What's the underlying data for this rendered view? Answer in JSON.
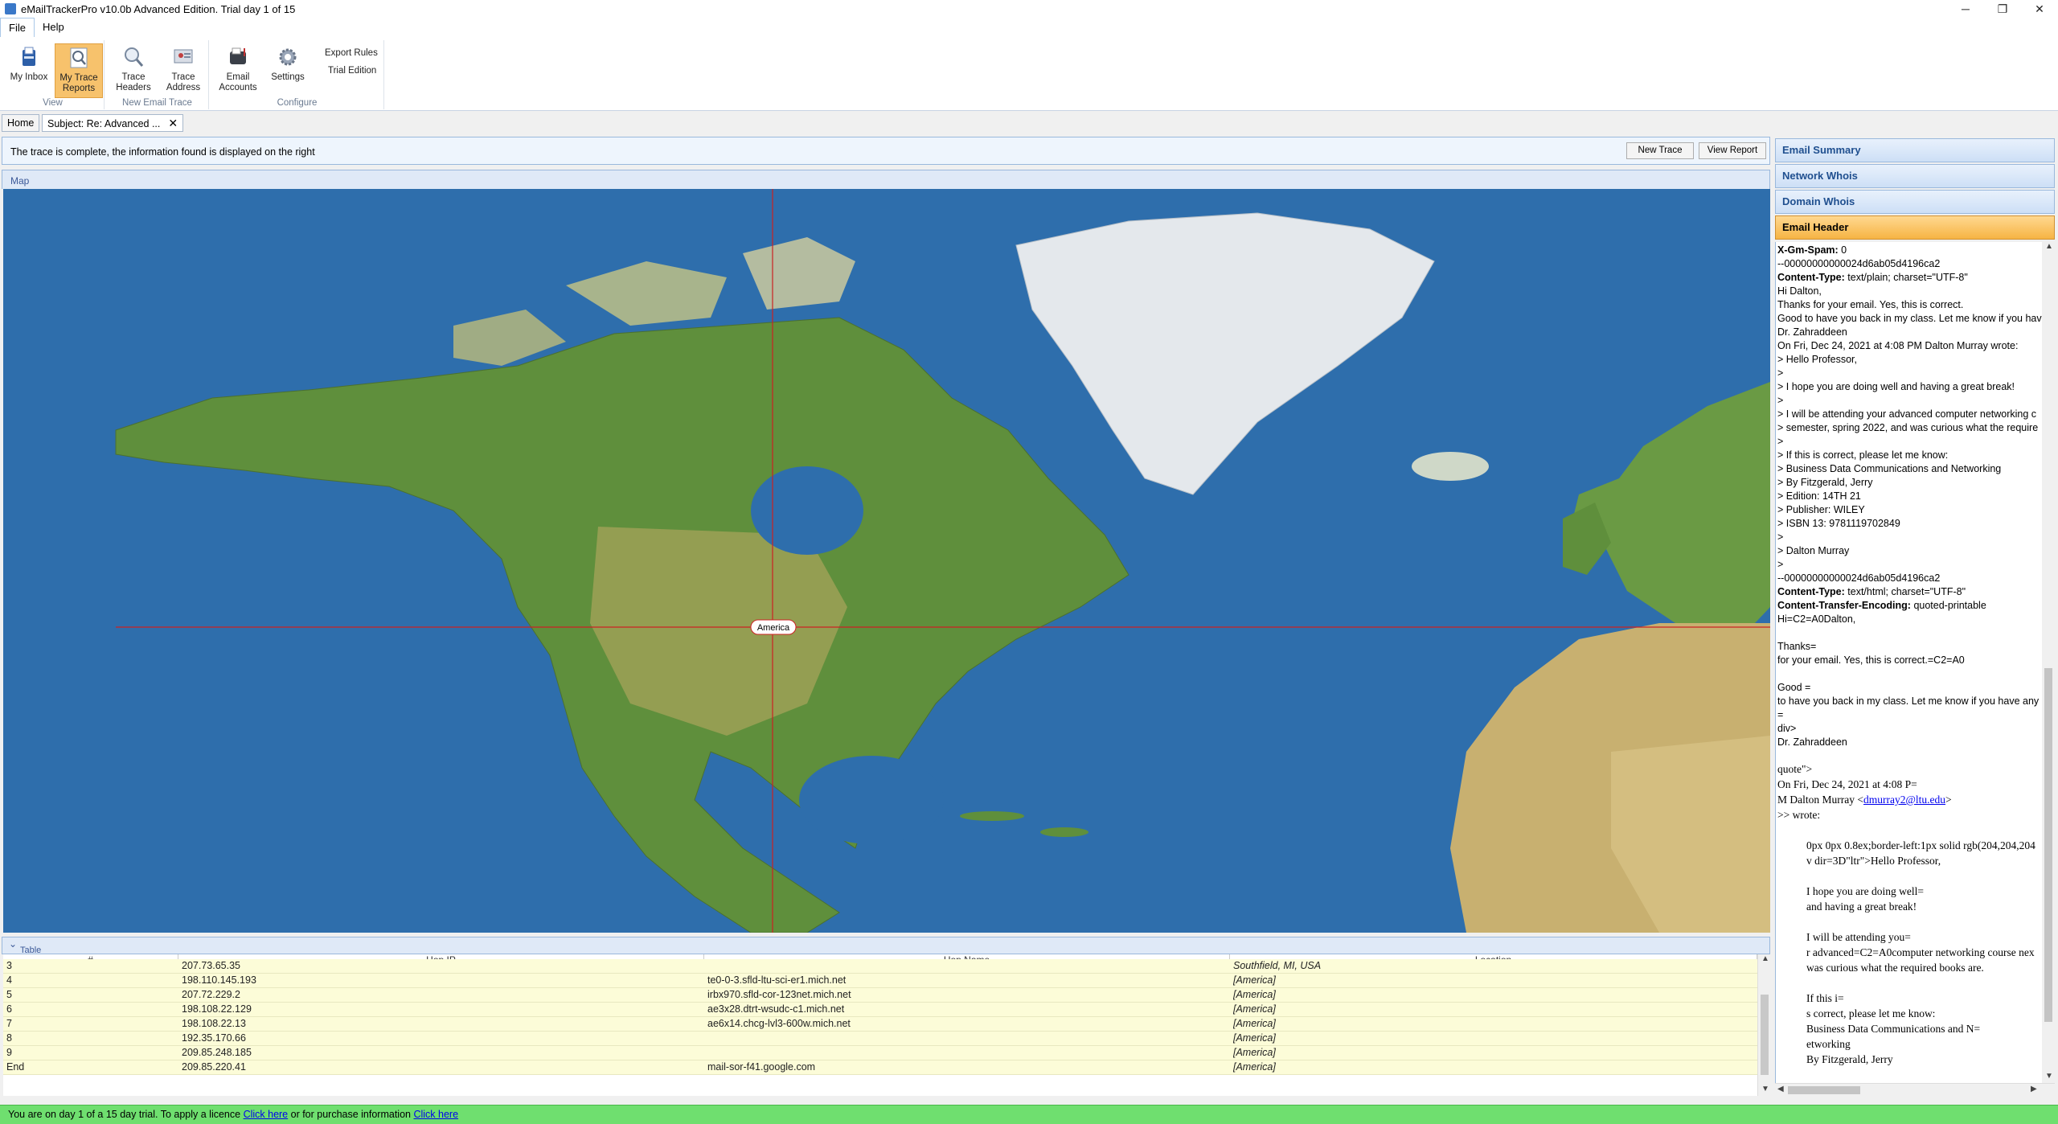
{
  "window": {
    "title": "eMailTrackerPro v10.0b Advanced Edition. Trial day 1 of 15",
    "minimize": "─",
    "restore": "❐",
    "close": "✕"
  },
  "menu": {
    "file": "File",
    "help": "Help"
  },
  "ribbon": {
    "my_inbox": "My Inbox",
    "my_trace_reports": "My Trace Reports",
    "view_group": "View",
    "trace_headers": "Trace Headers",
    "trace_address": "Trace Address",
    "new_trace_group": "New Email Trace",
    "email_accounts": "Email Accounts",
    "settings": "Settings",
    "export_rules": "Export Rules",
    "trial_edition": "Trial Edition",
    "configure_group": "Configure"
  },
  "tabs": {
    "home": "Home",
    "subject": "Subject: Re: Advanced ...",
    "close": "✕"
  },
  "message": {
    "text": "The trace is complete, the information found is displayed on the right",
    "new_trace": "New Trace",
    "view_report": "View Report"
  },
  "map": {
    "header": "Map",
    "marker_label": "America"
  },
  "table": {
    "header": "Table",
    "columns": [
      "#",
      "Hop IP",
      "Hop Name",
      "Location"
    ],
    "rows": [
      {
        "n": "3",
        "ip": "207.73.65.35",
        "name": "",
        "loc": "Southfield, MI, USA"
      },
      {
        "n": "4",
        "ip": "198.110.145.193",
        "name": "te0-0-3.sfld-ltu-sci-er1.mich.net",
        "loc": "[America]"
      },
      {
        "n": "5",
        "ip": "207.72.229.2",
        "name": "irbx970.sfld-cor-123net.mich.net",
        "loc": "[America]"
      },
      {
        "n": "6",
        "ip": "198.108.22.129",
        "name": "ae3x28.dtrt-wsudc-c1.mich.net",
        "loc": "[America]"
      },
      {
        "n": "7",
        "ip": "198.108.22.13",
        "name": "ae6x14.chcg-lvl3-600w.mich.net",
        "loc": "[America]"
      },
      {
        "n": "8",
        "ip": "192.35.170.66",
        "name": "",
        "loc": "[America]"
      },
      {
        "n": "9",
        "ip": "209.85.248.185",
        "name": "",
        "loc": "[America]"
      },
      {
        "n": "End",
        "ip": "209.85.220.41",
        "name": "mail-sor-f41.google.com",
        "loc": "[America]"
      }
    ]
  },
  "trial": {
    "prefix": "You are on day 1 of a 15 day trial. To apply a licence ",
    "link1": "Click here",
    "middle": " or for purchase information ",
    "link2": "Click here"
  },
  "panel": {
    "email_summary": "Email Summary",
    "network_whois": "Network Whois",
    "domain_whois": "Domain Whois",
    "email_header": "Email Header"
  },
  "header_lines": [
    {
      "bold": "X-Gm-Spam:",
      "text": " 0"
    },
    {
      "bold": "",
      "text": "--00000000000024d6ab05d4196ca2"
    },
    {
      "bold": "Content-Type:",
      "text": " text/plain; charset=\"UTF-8\""
    },
    {
      "bold": "",
      "text": "Hi Dalton,"
    },
    {
      "bold": "",
      "text": "Thanks for your email. Yes, this is correct."
    },
    {
      "bold": "",
      "text": "Good to have you back in my class. Let me know if you have"
    },
    {
      "bold": "",
      "text": "Dr. Zahraddeen"
    },
    {
      "bold": "",
      "text": "On Fri, Dec 24, 2021 at 4:08 PM Dalton Murray  wrote:"
    },
    {
      "bold": "",
      "text": "> Hello Professor,"
    },
    {
      "bold": "",
      "text": ">"
    },
    {
      "bold": "",
      "text": "> I hope you are doing well and having a great break!"
    },
    {
      "bold": "",
      "text": ">"
    },
    {
      "bold": "",
      "text": "> I will be attending your advanced computer networking c"
    },
    {
      "bold": "",
      "text": "> semester, spring 2022, and was curious what the require"
    },
    {
      "bold": "",
      "text": ">"
    },
    {
      "bold": "",
      "text": "> If this is correct, please let me know:"
    },
    {
      "bold": "",
      "text": "> Business Data Communications and Networking"
    },
    {
      "bold": "",
      "text": "> By Fitzgerald, Jerry"
    },
    {
      "bold": "",
      "text": "> Edition: 14TH 21"
    },
    {
      "bold": "",
      "text": "> Publisher: WILEY"
    },
    {
      "bold": "",
      "text": "> ISBN 13: 9781119702849"
    },
    {
      "bold": "",
      "text": ">"
    },
    {
      "bold": "",
      "text": "> Dalton Murray"
    },
    {
      "bold": "",
      "text": ">"
    },
    {
      "bold": "",
      "text": "--00000000000024d6ab05d4196ca2"
    },
    {
      "bold": "Content-Type:",
      "text": " text/html; charset=\"UTF-8\""
    },
    {
      "bold": "Content-Transfer-Encoding:",
      "text": " quoted-printable"
    },
    {
      "bold": "",
      "text": "Hi=C2=A0Dalton,"
    },
    {
      "bold": "",
      "text": ""
    },
    {
      "bold": "",
      "text": "Thanks="
    },
    {
      "bold": "",
      "text": "for your email. Yes, this is correct.=C2=A0"
    },
    {
      "bold": "",
      "text": ""
    },
    {
      "bold": "",
      "text": "Good ="
    },
    {
      "bold": "",
      "text": "to have you back in my class. Let me know if you have any q"
    },
    {
      "bold": "",
      "text": "="
    },
    {
      "bold": "",
      "text": "div>"
    },
    {
      "bold": "",
      "text": "Dr. Zahraddeen"
    }
  ],
  "html_lines": [
    {
      "text": "quote\">",
      "indent": 0
    },
    {
      "text": "On Fri, Dec 24, 2021 at 4:08 P=",
      "indent": 0
    },
    {
      "text": "M Dalton Murray <",
      "link": "dmurray2@ltu.edu",
      "after": ">",
      "indent": 0
    },
    {
      "text": ">> wrote:",
      "indent": 0
    },
    {
      "text": "",
      "indent": 0
    },
    {
      "text": "0px 0px 0.8ex;border-left:1px solid rgb(204,204,204",
      "indent": 1
    },
    {
      "text": "v dir=3D\"ltr\">Hello Professor,",
      "indent": 1
    },
    {
      "text": "",
      "indent": 0
    },
    {
      "text": "I hope you are doing well=",
      "indent": 1
    },
    {
      "text": "and having a great break!",
      "indent": 1
    },
    {
      "text": "",
      "indent": 0
    },
    {
      "text": "I will be attending you=",
      "indent": 1
    },
    {
      "text": "r advanced=C2=A0computer networking course nex",
      "indent": 1
    },
    {
      "text": "was curious what the required books are.",
      "indent": 1
    },
    {
      "text": "",
      "indent": 0
    },
    {
      "text": "If this i=",
      "indent": 1
    },
    {
      "text": "s correct, please let me know:",
      "indent": 1
    },
    {
      "text": "Business Data Communications and N=",
      "indent": 1
    },
    {
      "text": "etworking",
      "indent": 1
    },
    {
      "text": "By Fitzgerald, Jerry",
      "indent": 1
    }
  ]
}
